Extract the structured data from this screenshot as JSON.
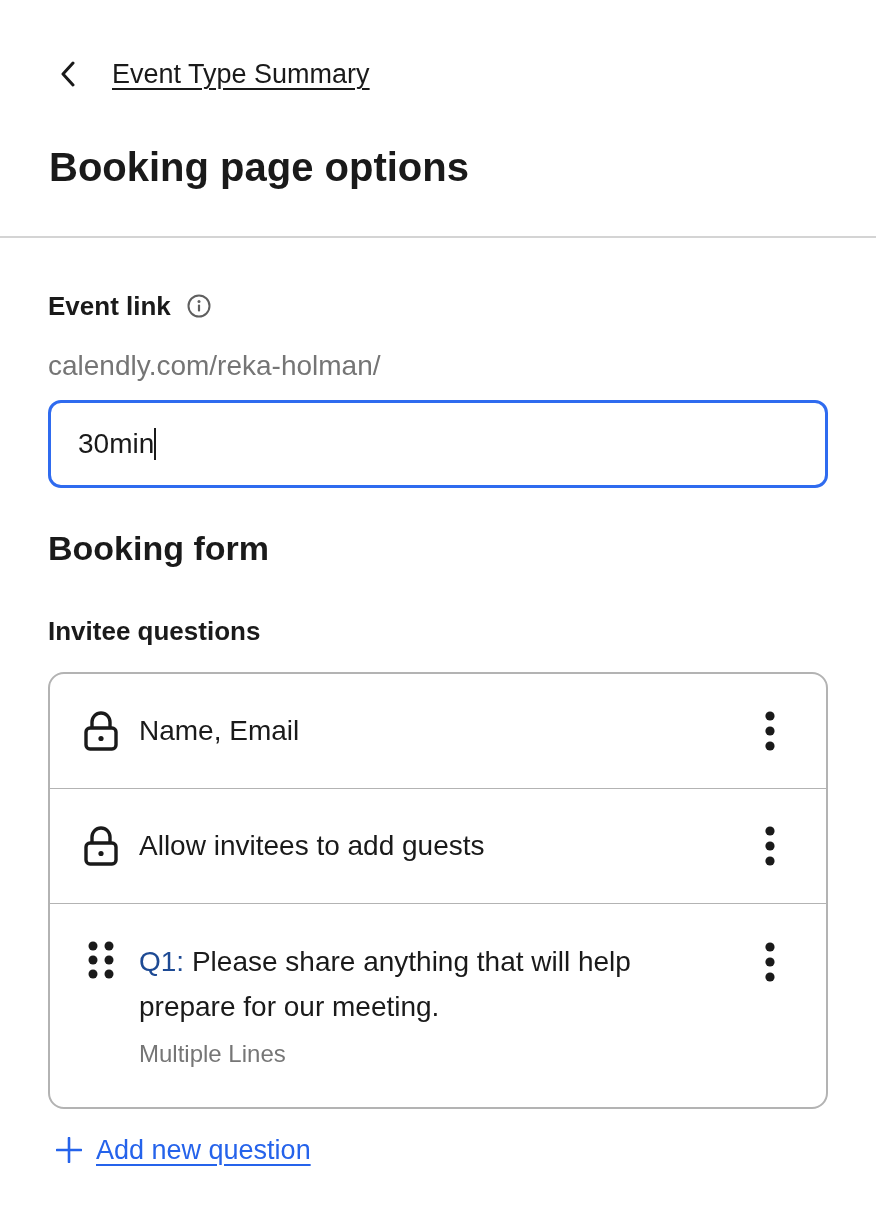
{
  "back_link": {
    "label": "Event Type Summary"
  },
  "title": "Booking page options",
  "event_link": {
    "label": "Event link",
    "url_prefix": "calendly.com/reka-holman/",
    "input": {
      "value": "30min",
      "focused": true
    }
  },
  "booking_form": {
    "title": "Booking form",
    "section_label": "Invitee questions",
    "questions": [
      {
        "kind": "locked",
        "label": "Name, Email"
      },
      {
        "kind": "locked",
        "label": "Allow invitees to add guests"
      },
      {
        "kind": "custom",
        "number": "Q1:",
        "label": "Please share anything that will help prepare for our meeting.",
        "answer_type": "Multiple Lines"
      }
    ],
    "add_button": {
      "label": "Add new question"
    }
  }
}
